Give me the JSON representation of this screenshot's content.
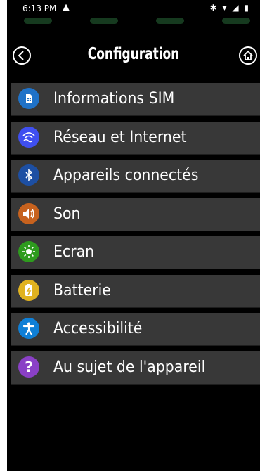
{
  "status": {
    "time": "6:13 PM",
    "alert_icon": "warning-triangle-icon",
    "right_icons": "✱ ▾ ◢ ▮"
  },
  "header": {
    "title": "Configuration",
    "back_icon": "back-arrow-icon",
    "home_icon": "home-icon"
  },
  "colors": {
    "background": "#000000",
    "menu_item_bg": "#383838",
    "sim": "#1f72c8",
    "network": "#3f4ff0",
    "bluetooth": "#1d4fa3",
    "sound": "#c7621e",
    "screen": "#2e9b1e",
    "battery": "#e0b21f",
    "accessibility": "#0f7fd6",
    "about": "#8a40c6"
  },
  "menu": {
    "items": [
      {
        "label": "Informations SIM",
        "icon": "sim-card-icon"
      },
      {
        "label": "Réseau et Internet",
        "icon": "wifi-icon"
      },
      {
        "label": "Appareils connectés",
        "icon": "bluetooth-icon"
      },
      {
        "label": "Son",
        "icon": "speaker-icon"
      },
      {
        "label": "Ecran",
        "icon": "brightness-icon"
      },
      {
        "label": "Batterie",
        "icon": "battery-icon"
      },
      {
        "label": "Accessibilité",
        "icon": "accessibility-icon"
      },
      {
        "label": "Au sujet de l'appareil",
        "icon": "help-icon"
      }
    ]
  }
}
